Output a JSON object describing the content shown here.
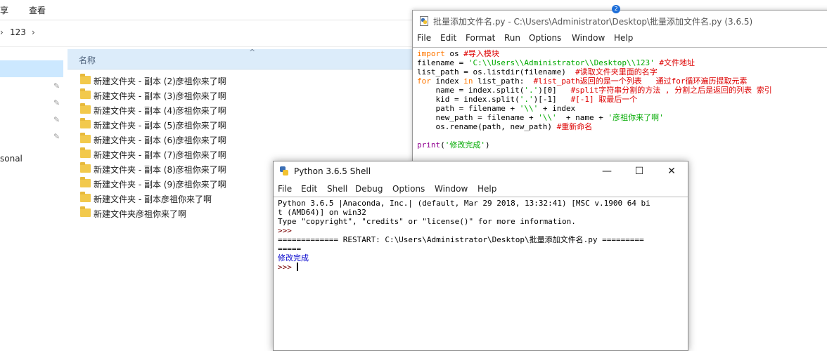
{
  "explorer": {
    "ribbon_tabs": [
      "享",
      "查看"
    ],
    "breadcrumb": "123",
    "nav_personal": "sonal",
    "column_header": "名称",
    "files": [
      "新建文件夹 - 副本 (2)彦祖你来了啊",
      "新建文件夹 - 副本 (3)彦祖你来了啊",
      "新建文件夹 - 副本 (4)彦祖你来了啊",
      "新建文件夹 - 副本 (5)彦祖你来了啊",
      "新建文件夹 - 副本 (6)彦祖你来了啊",
      "新建文件夹 - 副本 (7)彦祖你来了啊",
      "新建文件夹 - 副本 (8)彦祖你来了啊",
      "新建文件夹 - 副本 (9)彦祖你来了啊",
      "新建文件夹 - 副本彦祖你来了啊",
      "新建文件夹彦祖你来了啊"
    ]
  },
  "editor": {
    "title": "批量添加文件名.py - C:\\Users\\Administrator\\Desktop\\批量添加文件名.py (3.6.5)",
    "menus": [
      "File",
      "Edit",
      "Format",
      "Run",
      "Options",
      "Window",
      "Help"
    ],
    "badge": "2"
  },
  "shell": {
    "title": "Python 3.6.5 Shell",
    "controls": [
      "—",
      "☐",
      "✕"
    ],
    "menus": [
      "File",
      "Edit",
      "Shell",
      "Debug",
      "Options",
      "Window",
      "Help"
    ]
  },
  "colors": {
    "keyword": "#ff7700",
    "string": "#00aa00",
    "comment": "#dd0000",
    "builtin": "#900090",
    "prompt": "#770000",
    "output": "#0000cc",
    "selection": "#cce8ff"
  }
}
